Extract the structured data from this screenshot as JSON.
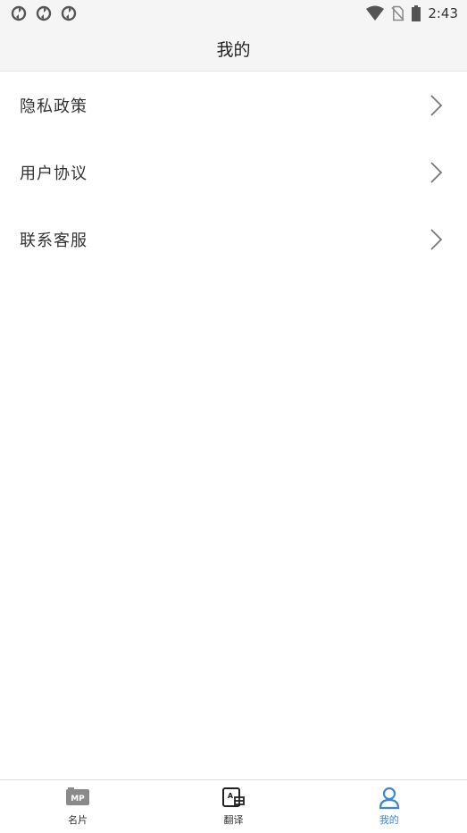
{
  "status_bar": {
    "time": "2:43",
    "left_icons": [
      "sync-icon",
      "sync-icon",
      "sync-icon"
    ],
    "right_icons": [
      "wifi-icon",
      "no-sim-icon",
      "battery-icon"
    ]
  },
  "header": {
    "title": "我的"
  },
  "menu": {
    "items": [
      {
        "label": "隐私政策",
        "icon": "chevron-right-icon"
      },
      {
        "label": "用户协议",
        "icon": "chevron-right-icon"
      },
      {
        "label": "联系客服",
        "icon": "chevron-right-icon"
      }
    ]
  },
  "tabs": [
    {
      "label": "名片",
      "icon": "mp-card-icon",
      "active": false
    },
    {
      "label": "翻译",
      "icon": "translate-icon",
      "active": false
    },
    {
      "label": "我的",
      "icon": "user-profile-icon",
      "active": true
    }
  ],
  "colors": {
    "accent": "#3b86d9",
    "header_bg": "#f5f5f5",
    "text": "#333333"
  }
}
